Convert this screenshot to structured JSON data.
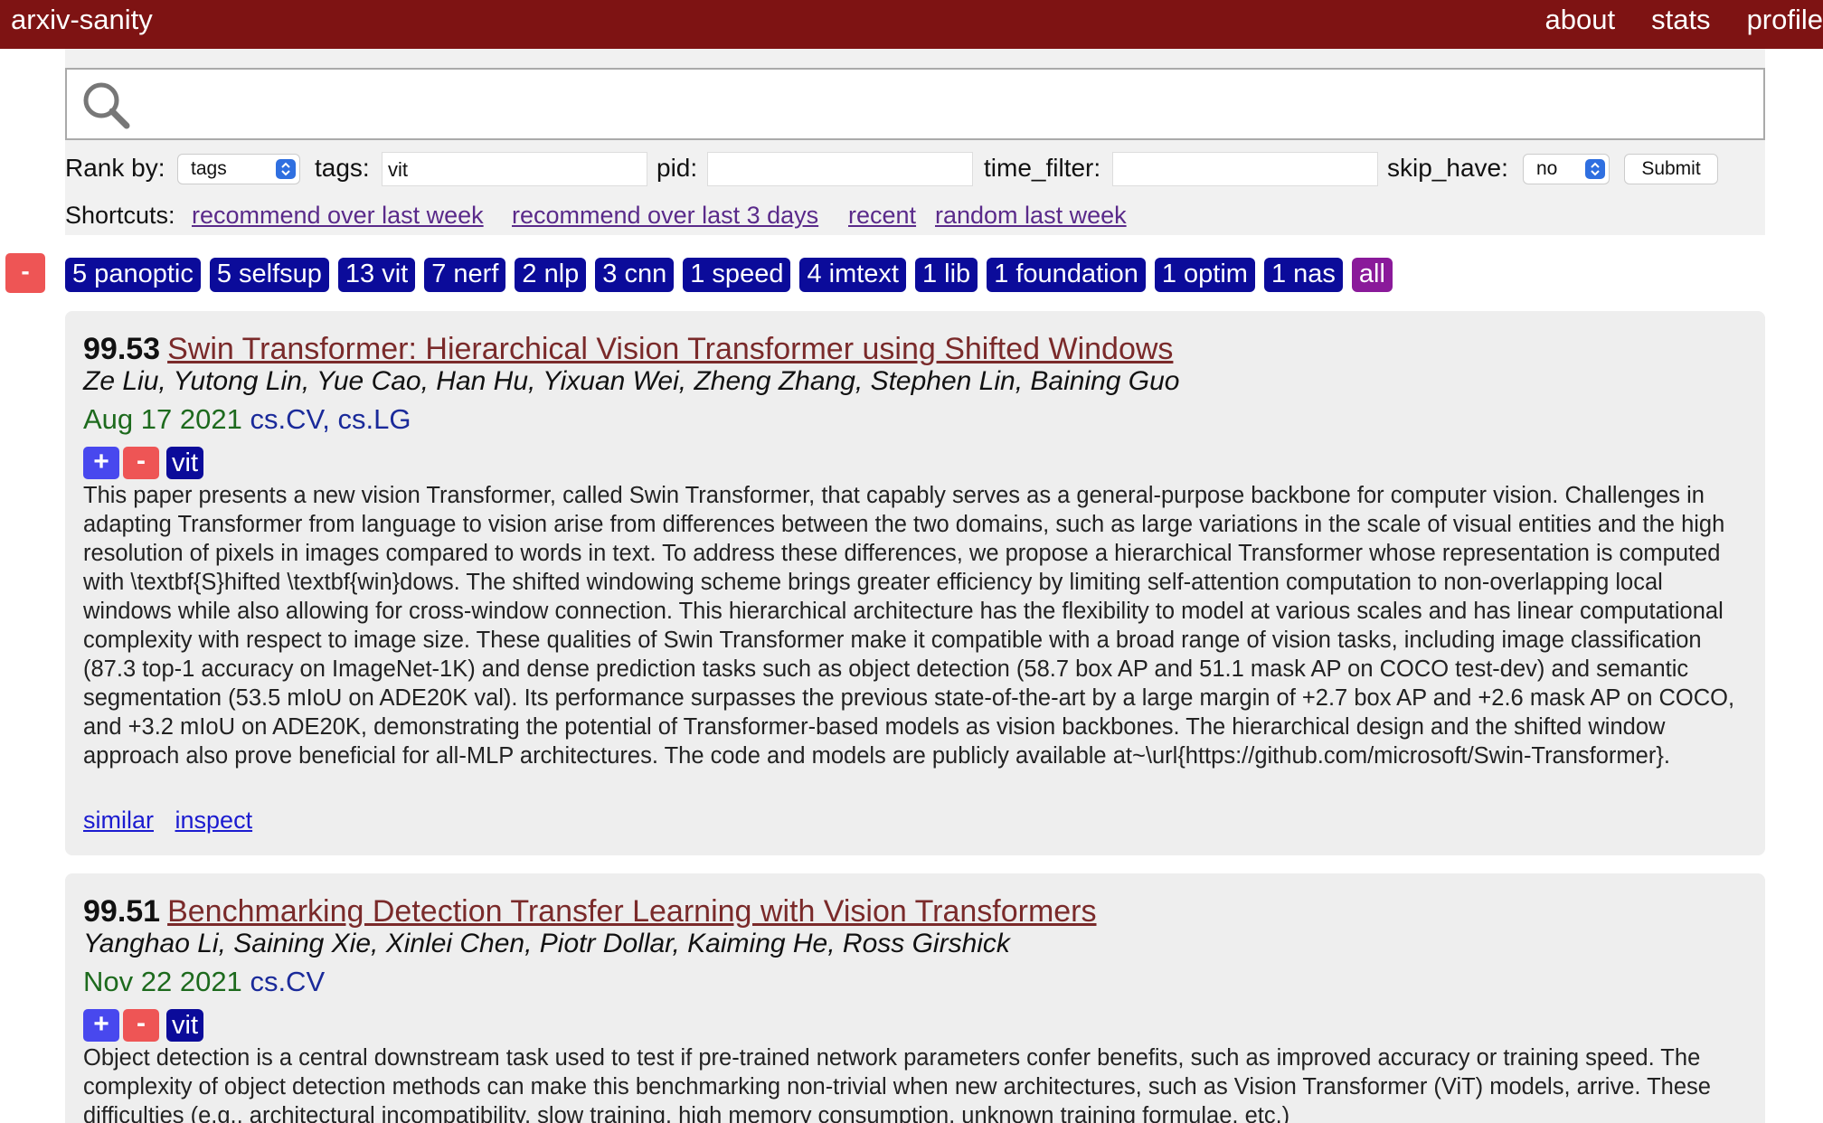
{
  "header": {
    "brand": "arxiv-sanity",
    "nav": [
      "about",
      "stats",
      "profile"
    ]
  },
  "search": {
    "value": "",
    "placeholder": ""
  },
  "controls": {
    "rank_by_label": "Rank by:",
    "rank_by_value": "tags",
    "tags_label": "tags:",
    "tags_value": "vit",
    "pid_label": "pid:",
    "pid_value": "",
    "time_filter_label": "time_filter:",
    "time_filter_value": "",
    "skip_have_label": "skip_have:",
    "skip_have_value": "no",
    "submit_label": "Submit"
  },
  "shortcuts": {
    "label": "Shortcuts:",
    "links": [
      "recommend over last week",
      "recommend over last 3 days",
      "recent",
      "random last week"
    ]
  },
  "tagbar": {
    "minus_label": "-",
    "tags": [
      "5 panoptic",
      "5 selfsup",
      "13 vit",
      "7 nerf",
      "2 nlp",
      "3 cnn",
      "1 speed",
      "4 imtext",
      "1 lib",
      "1 foundation",
      "1 optim",
      "1 nas"
    ],
    "all_label": "all"
  },
  "papers": [
    {
      "score": "99.53",
      "title": "Swin Transformer: Hierarchical Vision Transformer using Shifted Windows",
      "authors": "Ze Liu, Yutong Lin, Yue Cao, Han Hu, Yixuan Wei, Zheng Zhang, Stephen Lin, Baining Guo",
      "date": "Aug 17 2021",
      "categories": "cs.CV, cs.LG",
      "plus": "+",
      "minus": "-",
      "tag": "vit",
      "abstract": "This paper presents a new vision Transformer, called Swin Transformer, that capably serves as a general-purpose backbone for computer vision. Challenges in adapting Transformer from language to vision arise from differences between the two domains, such as large variations in the scale of visual entities and the high resolution of pixels in images compared to words in text. To address these differences, we propose a hierarchical Transformer whose representation is computed with \\textbf{S}hifted \\textbf{win}dows. The shifted windowing scheme brings greater efficiency by limiting self-attention computation to non-overlapping local windows while also allowing for cross-window connection. This hierarchical architecture has the flexibility to model at various scales and has linear computational complexity with respect to image size. These qualities of Swin Transformer make it compatible with a broad range of vision tasks, including image classification (87.3 top-1 accuracy on ImageNet-1K) and dense prediction tasks such as object detection (58.7 box AP and 51.1 mask AP on COCO test-dev) and semantic segmentation (53.5 mIoU on ADE20K val). Its performance surpasses the previous state-of-the-art by a large margin of +2.7 box AP and +2.6 mask AP on COCO, and +3.2 mIoU on ADE20K, demonstrating the potential of Transformer-based models as vision backbones. The hierarchical design and the shifted window approach also prove beneficial for all-MLP architectures. The code and models are publicly available at~\\url{https://github.com/microsoft/Swin-Transformer}.",
      "similar": "similar",
      "inspect": "inspect"
    },
    {
      "score": "99.51",
      "title": "Benchmarking Detection Transfer Learning with Vision Transformers",
      "authors": "Yanghao Li, Saining Xie, Xinlei Chen, Piotr Dollar, Kaiming He, Ross Girshick",
      "date": "Nov 22 2021",
      "categories": "cs.CV",
      "plus": "+",
      "minus": "-",
      "tag": "vit",
      "abstract": "Object detection is a central downstream task used to test if pre-trained network parameters confer benefits, such as improved accuracy or training speed. The complexity of object detection methods can make this benchmarking non-trivial when new architectures, such as Vision Transformer (ViT) models, arrive. These difficulties (e.g., architectural incompatibility, slow training, high memory consumption, unknown training formulae, etc.)"
    }
  ],
  "colors": {
    "header_bg": "#7e1313",
    "tag_bg": "#0b0b9a",
    "all_tag_bg": "#8a1a9a",
    "minus_bg": "#ee5555",
    "plus_bg": "#4848ee",
    "title_link": "#7a2a2a",
    "date": "#1d6a1d",
    "categories": "#1a2a9a"
  },
  "icons": {
    "search": "search-icon",
    "select_arrows": "chevron-updown-icon"
  }
}
